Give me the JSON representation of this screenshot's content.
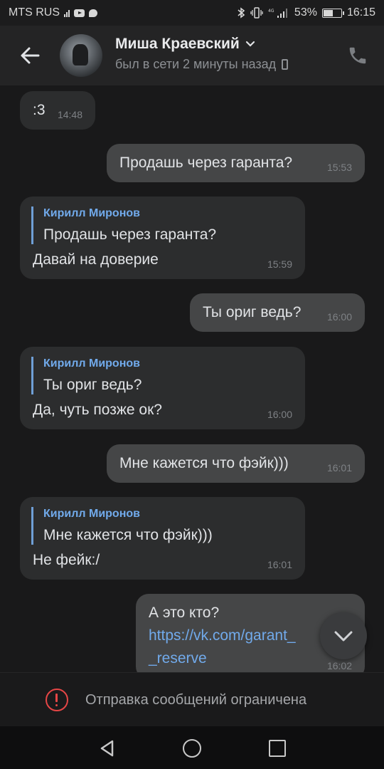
{
  "status_bar": {
    "carrier": "MTS RUS",
    "battery": "53%",
    "battery_fill": 0.53,
    "time": "16:15"
  },
  "header": {
    "name": "Миша Краевский",
    "presence": "был в сети 2 минуты назад"
  },
  "messages": [
    {
      "dir": "in",
      "text": ":3",
      "time": "14:48"
    },
    {
      "dir": "out",
      "text": "Продашь через гаранта?",
      "time": "15:53"
    },
    {
      "dir": "in",
      "reply_author": "Кирилл Миронов",
      "reply_text": "Продашь через гаранта?",
      "text": "Давай на доверие",
      "time": "15:59"
    },
    {
      "dir": "out",
      "text": "Ты ориг ведь?",
      "time": "16:00"
    },
    {
      "dir": "in",
      "reply_author": "Кирилл Миронов",
      "reply_text": "Ты ориг ведь?",
      "text": "Да, чуть позже ок?",
      "time": "16:00"
    },
    {
      "dir": "out",
      "text": "Мне кажется что фэйк)))",
      "time": "16:01"
    },
    {
      "dir": "in",
      "reply_author": "Кирилл Миронов",
      "reply_text": "Мне кажется что фэйк)))",
      "text": "Не фейк:/",
      "time": "16:01"
    },
    {
      "dir": "out",
      "text": "А это кто?",
      "link_line1": "https://vk.com/garant_",
      "link_line2": "_reserve",
      "time": "16:02"
    }
  ],
  "restriction": {
    "text": "Отправка сообщений ограничена"
  },
  "icons": {
    "back": "arrow-left-icon",
    "call": "phone-icon",
    "presence_device": "mobile-icon",
    "scroll_down": "chevron-down-icon",
    "warning": "exclamation-circle-icon"
  },
  "colors": {
    "background": "#19191a",
    "header": "#242425",
    "bubble_in": "#2c2d2e",
    "bubble_out": "#454647",
    "link": "#71aaeb",
    "warning": "#e64646"
  }
}
